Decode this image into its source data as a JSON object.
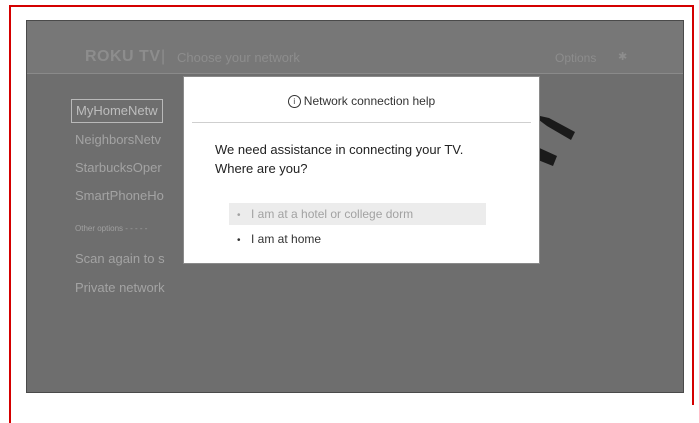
{
  "header": {
    "brand": "ROKU TV",
    "separator": "|",
    "title": "Choose your network",
    "options_label": "Options",
    "options_icon": "star-icon"
  },
  "networks": [
    {
      "label": "MyHomeNetw",
      "selected": true
    },
    {
      "label": "NeighborsNetv"
    },
    {
      "label": "StarbucksOper"
    },
    {
      "label": "SmartPhoneHo"
    }
  ],
  "other_options_label": "Other options - - - - -",
  "other_items": [
    {
      "label": "Scan again to s"
    },
    {
      "label": "Private network"
    }
  ],
  "dialog": {
    "title": "Network connection help",
    "title_icon": "info-icon",
    "message_line1": "We need assistance in connecting your TV.",
    "message_line2": "Where are you?",
    "options": [
      {
        "label": "I am at a hotel or college dorm",
        "highlighted": true
      },
      {
        "label": "I am at home"
      }
    ]
  },
  "colors": {
    "frame_border": "#d40000",
    "tv_background": "#6e6e6e",
    "dialog_background": "#ffffff"
  }
}
